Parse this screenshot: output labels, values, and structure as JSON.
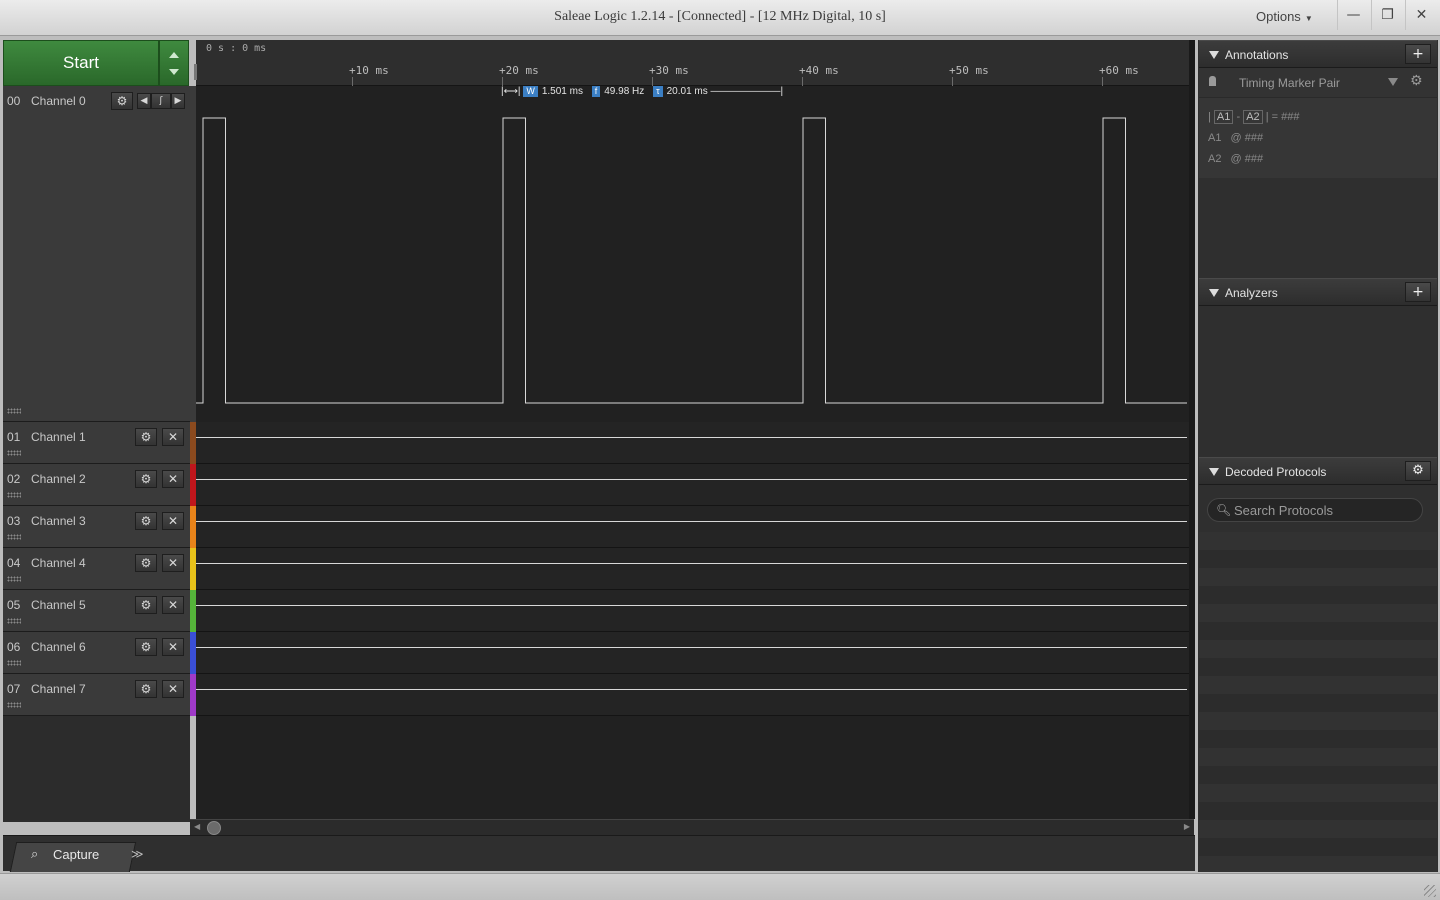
{
  "window": {
    "title": "Saleae Logic 1.2.14 - [Connected] - [12 MHz Digital, 10 s]",
    "options_label": "Options",
    "minimize_symbol": "—",
    "restore_symbol": "❐",
    "close_symbol": "✕"
  },
  "capture": {
    "start_label": "Start"
  },
  "ruler": {
    "origin": "0 s : 0 ms",
    "ticks": [
      "+10 ms",
      "+20 ms",
      "+30 ms",
      "+40 ms",
      "+50 ms",
      "+60 ms"
    ]
  },
  "measurement": {
    "width_badge": "W",
    "width": "1.501 ms",
    "freq_badge": "f",
    "frequency": "49.98 Hz",
    "period_badge": "τ",
    "period": "20.01 ms"
  },
  "channels": [
    {
      "num": "00",
      "name": "Channel 0",
      "color": "#3b3b3b"
    },
    {
      "num": "01",
      "name": "Channel 1",
      "color": "#8b4a1e"
    },
    {
      "num": "02",
      "name": "Channel 2",
      "color": "#c0161c"
    },
    {
      "num": "03",
      "name": "Channel 3",
      "color": "#e8831a"
    },
    {
      "num": "04",
      "name": "Channel 4",
      "color": "#e8c21a"
    },
    {
      "num": "05",
      "name": "Channel 5",
      "color": "#55b43a"
    },
    {
      "num": "06",
      "name": "Channel 6",
      "color": "#3a4fd6"
    },
    {
      "num": "07",
      "name": "Channel 7",
      "color": "#a03ac8"
    }
  ],
  "channel0_signal": {
    "high_pulses_ms": [
      [
        0.0,
        1.5
      ],
      [
        20.0,
        21.5
      ],
      [
        40.0,
        41.5
      ],
      [
        60.0,
        61.5
      ]
    ]
  },
  "bottom_tabs": {
    "capture_label": "Capture",
    "more_symbol": "≫"
  },
  "annotations": {
    "title": "Annotations",
    "marker_name": "Timing Marker Pair",
    "formula_a1": "A1",
    "formula_a2": "A2",
    "formula_sep": "-",
    "formula_eq": "= ###",
    "line2_label": "A1",
    "line2_value": "@ ###",
    "line3_label": "A2",
    "line3_value": "@ ###"
  },
  "analyzers": {
    "title": "Analyzers"
  },
  "decoded_protocols": {
    "title": "Decoded Protocols",
    "search_placeholder": "Search Protocols"
  },
  "icons": {
    "add": "plus-icon",
    "gear": "gear-icon",
    "close": "close-icon",
    "search": "search-icon"
  }
}
